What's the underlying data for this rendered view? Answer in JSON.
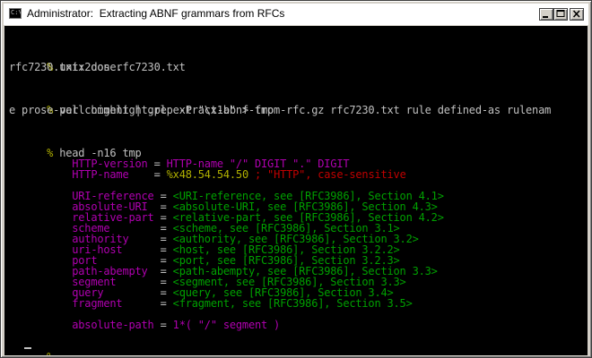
{
  "window": {
    "title": "Administrator:  Extracting ABNF grammars from RFCs",
    "icon_label": "C:\\"
  },
  "console": {
    "session": [
      {
        "prompt": "%",
        "command": " unix2dos rfc7230.txt"
      },
      {
        "output": "rfc7230.txt: done."
      },
      {
        "prompt": "%",
        "command": " perl highlight.pl extract-abnf-from-rfc.gz rfc7230.txt rule defined-as rulenam"
      },
      {
        "output": "e prose-val comment | grep -P \"\\x1b\" > tmp"
      },
      {
        "prompt": "%",
        "command": " head -n16 tmp"
      }
    ],
    "grammar": [
      {
        "rule": "    HTTP-version",
        "defined_as": " =",
        "parts": [
          " HTTP-name \"/\" DIGIT \".\" DIGIT"
        ]
      },
      {
        "rule": "    HTTP-name   ",
        "defined_as": " =",
        "hex": " %x48.54.54.50",
        "comment": " ; \"HTTP\", case-sensitive"
      },
      {
        "rule": "    URI-reference",
        "defined_as": " =",
        "prose": " <URI-reference, see [RFC3986], Section 4.1>"
      },
      {
        "rule": "    absolute-URI ",
        "defined_as": " =",
        "prose": " <absolute-URI, see [RFC3986], Section 4.3>"
      },
      {
        "rule": "    relative-part",
        "defined_as": " =",
        "prose": " <relative-part, see [RFC3986], Section 4.2>"
      },
      {
        "rule": "    scheme       ",
        "defined_as": " =",
        "prose": " <scheme, see [RFC3986], Section 3.1>"
      },
      {
        "rule": "    authority    ",
        "defined_as": " =",
        "prose": " <authority, see [RFC3986], Section 3.2>"
      },
      {
        "rule": "    uri-host     ",
        "defined_as": " =",
        "prose": " <host, see [RFC3986], Section 3.2.2>"
      },
      {
        "rule": "    port         ",
        "defined_as": " =",
        "prose": " <port, see [RFC3986], Section 3.2.3>"
      },
      {
        "rule": "    path-abempty ",
        "defined_as": " =",
        "prose": " <path-abempty, see [RFC3986], Section 3.3>"
      },
      {
        "rule": "    segment      ",
        "defined_as": " =",
        "prose": " <segment, see [RFC3986], Section 3.3>"
      },
      {
        "rule": "    query        ",
        "defined_as": " =",
        "prose": " <query, see [RFC3986], Section 3.4>"
      },
      {
        "rule": "    fragment     ",
        "defined_as": " =",
        "prose": " <fragment, see [RFC3986], Section 3.5>"
      },
      {
        "rule": "    absolute-path",
        "defined_as": " =",
        "parts": [
          " 1*( \"/\" segment )"
        ]
      }
    ],
    "final_prompt": "%",
    "colors": {
      "background": "#000000",
      "default_text": "#c0c0c0",
      "rulename": "#b000b0",
      "defined_as": "#c0c0c0",
      "hex": "#b0b000",
      "comment": "#c00000",
      "prose_val": "#00a000"
    }
  }
}
